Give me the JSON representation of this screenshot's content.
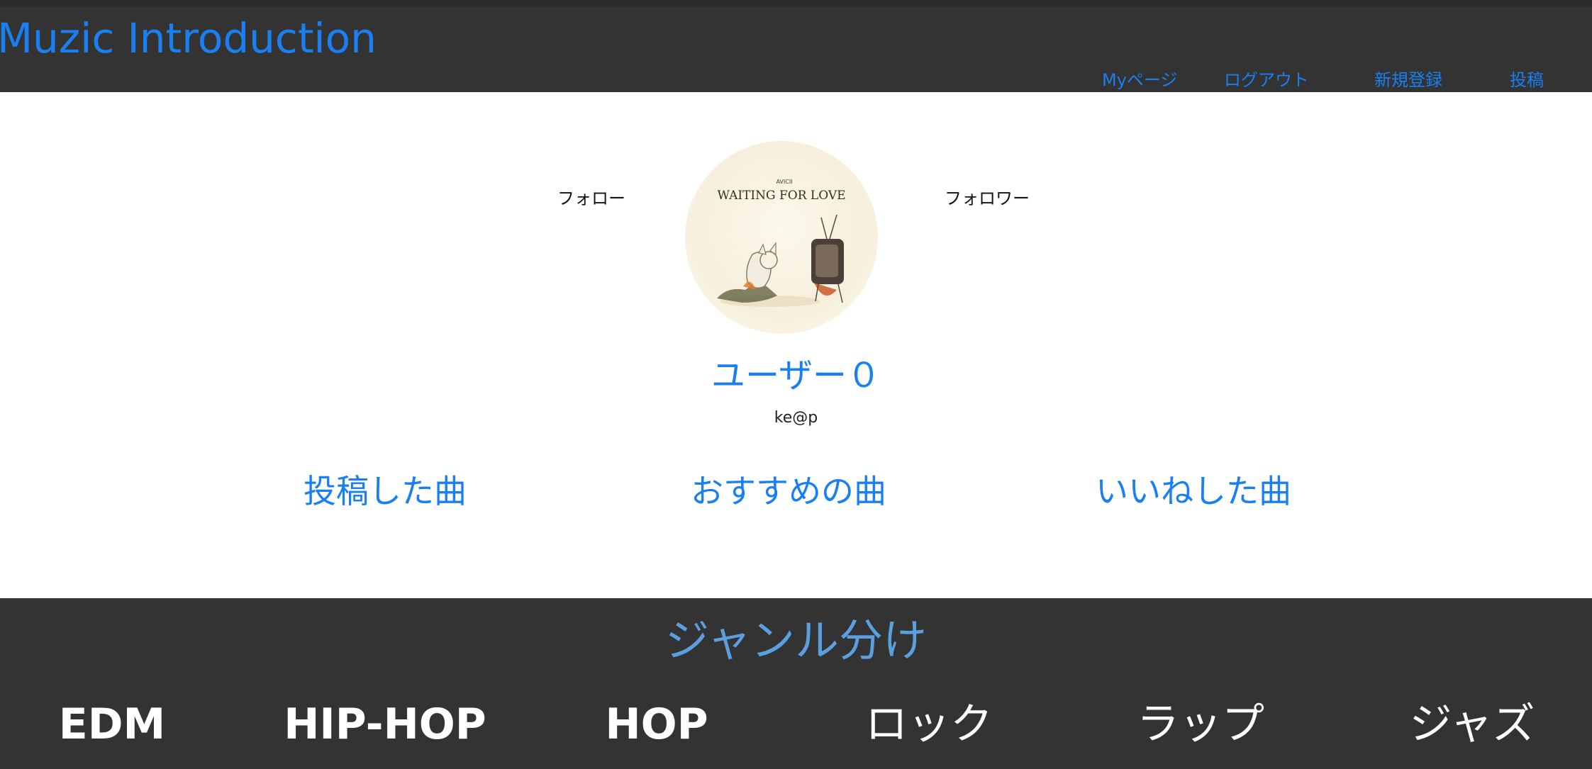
{
  "header": {
    "brand": "Muzic Introduction",
    "nav": [
      "Myページ",
      "ログアウト",
      "新規登録",
      "投稿"
    ]
  },
  "profile": {
    "follow_label": "フォロー",
    "follower_label": "フォロワー",
    "avatar_art": {
      "artist_text": "AVICII",
      "title_text": "WAITING FOR LOVE"
    },
    "username": "ユーザー０",
    "email": "ke@p"
  },
  "song_tabs": [
    "投稿した曲",
    "おすすめの曲",
    "いいねした曲"
  ],
  "genres": {
    "title": "ジャンル分け",
    "items": [
      "EDM",
      "HIP-HOP",
      "HOP",
      "ロック",
      "ラップ",
      "ジャズ"
    ]
  },
  "colors": {
    "header_bg": "#333333",
    "link": "#1a7ff0",
    "genre_title": "#5c9fe0",
    "genre_text": "#ffffff"
  }
}
